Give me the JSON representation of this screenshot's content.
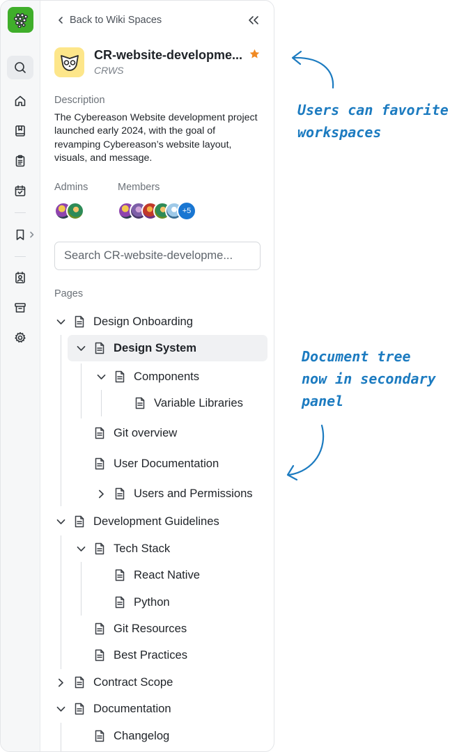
{
  "nav": {
    "back_label": "Back to Wiki Spaces",
    "rail_icons": [
      "search-icon",
      "home-icon",
      "wiki-book-icon",
      "clipboard-icon",
      "calendar-check-icon",
      "bookmark-icon",
      "contact-icon",
      "archive-icon",
      "settings-icon"
    ]
  },
  "workspace": {
    "name": "CR-website-developme...",
    "code": "CRWS",
    "favorited": true,
    "description_label": "Description",
    "description": "The Cybereason Website development project launched early 2024, with the goal of revamping Cybereason’s website layout, visuals, and message.",
    "admins_label": "Admins",
    "members_label": "Members",
    "members_more": "+5"
  },
  "search": {
    "placeholder": "Search CR-website-developme..."
  },
  "pages": {
    "label": "Pages",
    "items": [
      {
        "label": "Design Onboarding",
        "expander": "expanded"
      },
      {
        "label": "Design System",
        "expander": "expanded",
        "selected": true
      },
      {
        "label": "Components",
        "expander": "expanded"
      },
      {
        "label": "Variable Libraries",
        "expander": "none"
      },
      {
        "label": "Git overview",
        "expander": "none"
      },
      {
        "label": "User Documentation",
        "expander": "none"
      },
      {
        "label": "Users and Permissions",
        "expander": "collapsed"
      },
      {
        "label": "Development Guidelines",
        "expander": "expanded"
      },
      {
        "label": "Tech Stack",
        "expander": "expanded"
      },
      {
        "label": "React Native",
        "expander": "none"
      },
      {
        "label": "Python",
        "expander": "none"
      },
      {
        "label": "Git Resources",
        "expander": "none"
      },
      {
        "label": "Best Practices",
        "expander": "none"
      },
      {
        "label": "Contract Scope",
        "expander": "collapsed"
      },
      {
        "label": "Documentation",
        "expander": "expanded"
      },
      {
        "label": "Changelog",
        "expander": "none"
      }
    ]
  },
  "annotations": {
    "favorite_note_line1": "Users can favorite",
    "favorite_note_line2": "workspaces",
    "tree_note_line1": "Document tree",
    "tree_note_line2": "now in secondary",
    "tree_note_line3": "panel"
  },
  "colors": {
    "brand": "#3fae2a",
    "star": "#f08a24",
    "annotation": "#1c7bc0",
    "badge": "#1976d2"
  }
}
